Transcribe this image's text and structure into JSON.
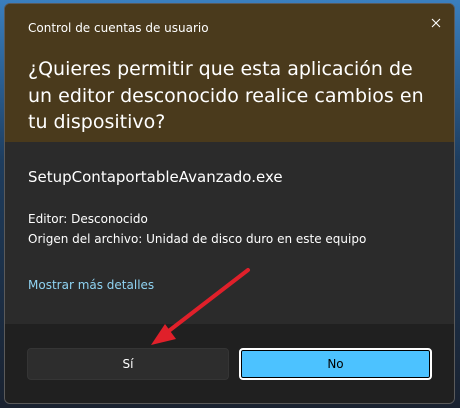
{
  "window": {
    "title": "Control de cuentas de usuario",
    "close_icon": "close-icon"
  },
  "prompt": {
    "question": "¿Quieres permitir que esta aplicación de un editor desconocido realice cambios en tu dispositivo?"
  },
  "program": {
    "name": "SetupContaportableAvanzado.exe",
    "publisher": "Editor: Desconocido",
    "origin": "Origen del archivo: Unidad de disco duro en este equipo",
    "details_link": "Mostrar más detalles"
  },
  "buttons": {
    "yes_label": "Sí",
    "no_label": "No"
  },
  "colors": {
    "header_bg": "#4a3a1c",
    "body_bg": "#2b2b2b",
    "footer_bg": "#202020",
    "accent": "#4cc2ff",
    "link": "#8fd3f2",
    "annotation_arrow": "#e0202a"
  },
  "annotation": {
    "icon": "red-arrow-icon",
    "points_to": "yes-button"
  }
}
